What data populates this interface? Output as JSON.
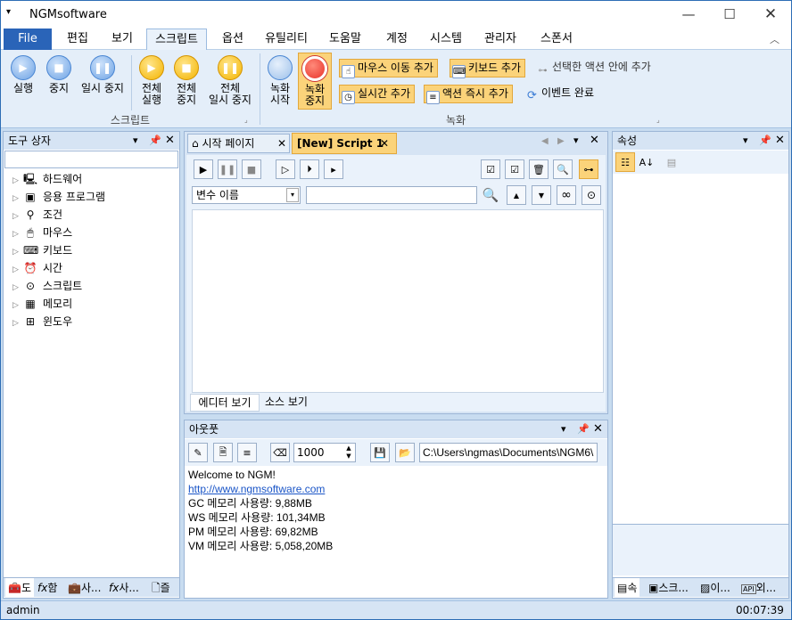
{
  "app": {
    "title": "NGMsoftware"
  },
  "menu": {
    "file": "File",
    "tabs": [
      "편집",
      "보기",
      "스크립트",
      "옵션",
      "유틸리티",
      "도움말",
      "계정",
      "시스템",
      "관리자",
      "스폰서"
    ]
  },
  "ribbon": {
    "script_group": {
      "label": "스크립트",
      "run": "실행",
      "stop": "중지",
      "pause": "일시 중지",
      "run_all_1": "전체",
      "run_all_2": "실행",
      "stop_all_1": "전체",
      "stop_all_2": "중지",
      "pause_all_1": "전체",
      "pause_all_2": "일시 중지"
    },
    "record_group": {
      "label": "녹화",
      "start_1": "녹화",
      "start_2": "시작",
      "stop_1": "녹화",
      "stop_2": "중지",
      "add_mouse": "마우스 이동 추가",
      "add_keyboard": "키보드 추가",
      "add_in_action": "선택한 액션 안에 추가",
      "add_realtime": "실시간 추가",
      "add_action_now": "액션 즉시 추가",
      "event_done": "이벤트 완료"
    }
  },
  "toolbox": {
    "title": "도구 상자",
    "items": [
      "하드웨어",
      "응용 프로그램",
      "조건",
      "마우스",
      "키보드",
      "시간",
      "스크립트",
      "메모리",
      "윈도우"
    ],
    "tabs": [
      "도",
      "함",
      "사...",
      "사...",
      "즐"
    ]
  },
  "editor": {
    "tabs": [
      "시작 페이지",
      "[New] Script 1"
    ],
    "var_select": "변수 이름",
    "search_placeholder": "",
    "view_tabs": [
      "에디터 보기",
      "소스 보기"
    ]
  },
  "output": {
    "title": "아웃풋",
    "interval": "1000",
    "path": "C:\\Users\\ngmas\\Documents\\NGM6\\",
    "lines": [
      "Welcome to NGM!",
      "http://www.ngmsoftware.com",
      "GC 메모리 사용량: 9,88MB",
      "WS 메모리 사용량: 101,34MB",
      "PM 메모리 사용량: 69,82MB",
      "VM 메모리 사용량: 5,058,20MB"
    ]
  },
  "properties": {
    "title": "속성",
    "tabs": [
      "속",
      "스크...",
      "이...",
      "외..."
    ],
    "api": "API"
  },
  "status": {
    "user": "admin",
    "time": "00:07:39"
  },
  "colors": {
    "accent": "#2a64b8",
    "highlight": "#fbd37a",
    "record": "#e8322a"
  }
}
